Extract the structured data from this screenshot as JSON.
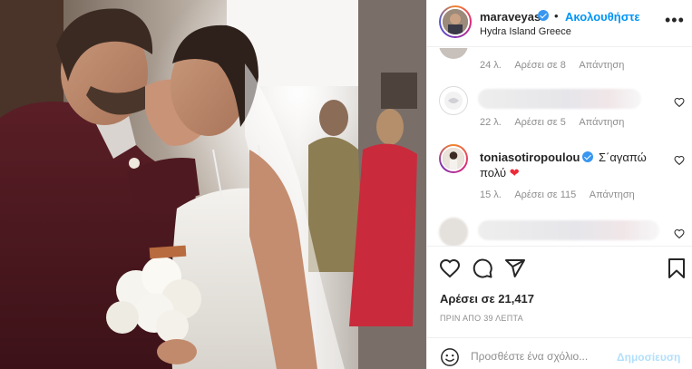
{
  "post": {
    "username": "maraveyas",
    "verified": true,
    "separator": "•",
    "follow_label": "Ακολουθήστε",
    "location": "Hydra Island Greece",
    "more_icon": "more-options-icon"
  },
  "comments": [
    {
      "user": "",
      "text": "",
      "blurred": true,
      "time": "24 λ.",
      "likes": "Αρέσει σε 8",
      "reply": "Απάντηση",
      "partial": true
    },
    {
      "user": "",
      "text": "",
      "blurred": true,
      "time": "22 λ.",
      "likes": "Αρέσει σε 5",
      "reply": "Απάντηση"
    },
    {
      "user": "toniasotiropoulou",
      "verified": true,
      "text_line1": "Σ΄αγαπώ",
      "text_line2": "πολύ",
      "emoji": "❤",
      "time": "15 λ.",
      "likes": "Αρέσει σε 115",
      "reply": "Απάντηση"
    },
    {
      "user": "",
      "text": "",
      "blurred": true,
      "partial": true
    }
  ],
  "actions": {
    "like_icon": "heart-icon",
    "comment_icon": "comment-icon",
    "share_icon": "share-icon",
    "save_icon": "bookmark-icon"
  },
  "likes_text": "Αρέσει σε 21,417",
  "time_ago": "ΠΡΙΝ ΑΠΟ 39 ΛΕΠΤΑ",
  "add_comment": {
    "placeholder": "Προσθέστε ένα σχόλιο...",
    "post_label": "Δημοσίευση"
  },
  "colors": {
    "accent": "#0095f6",
    "verified": "#3897f0",
    "muted": "#8e8e8e",
    "text": "#262626",
    "heart": "#ed2939"
  }
}
